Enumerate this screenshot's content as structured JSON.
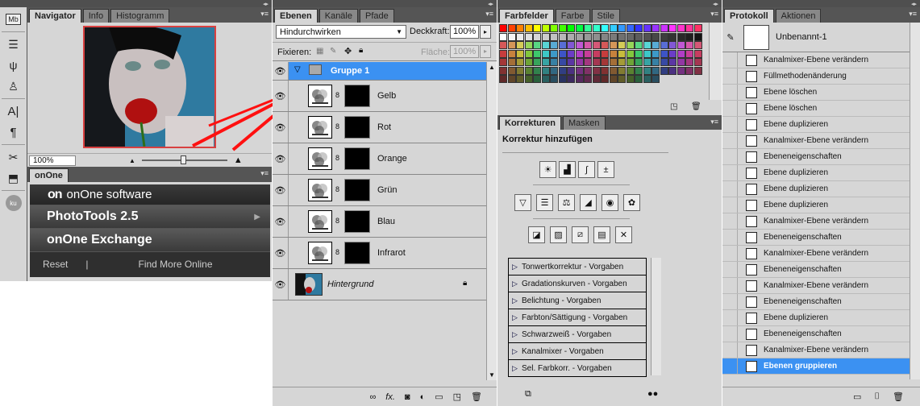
{
  "navigator_panel": {
    "tabs": [
      "Navigator",
      "Info",
      "Histogramm"
    ],
    "zoom": "100%"
  },
  "onone_panel": {
    "tab": "onOne",
    "logo_mark": "on",
    "brand": "onOne software",
    "item1": "PhotoTools 2.5",
    "item2": "onOne Exchange",
    "reset": "Reset",
    "sep": "|",
    "find_more": "Find More Online"
  },
  "layers_panel": {
    "tabs": [
      "Ebenen",
      "Kanäle",
      "Pfade"
    ],
    "blend_mode": "Hindurchwirken",
    "opacity_label": "Deckkraft:",
    "opacity": "100%",
    "fix_label": "Fixieren:",
    "fill_label": "Fläche:",
    "fill": "100%",
    "group": "Gruppe 1",
    "layers": [
      "Gelb",
      "Rot",
      "Orange",
      "Grün",
      "Blau",
      "Infrarot"
    ],
    "background": "Hintergrund",
    "bottom_icons": [
      "link-icon",
      "fx-icon",
      "mask-icon",
      "adjustment-icon",
      "folder-icon",
      "new-layer-icon",
      "trash-icon"
    ]
  },
  "swatches_panel": {
    "tabs": [
      "Farbfelder",
      "Farbe",
      "Stile"
    ]
  },
  "corrections_panel": {
    "tabs": [
      "Korrekturen",
      "Masken"
    ],
    "title": "Korrektur hinzufügen",
    "presets": [
      "Tonwertkorrektur - Vorgaben",
      "Gradationskurven - Vorgaben",
      "Belichtung - Vorgaben",
      "Farbton/Sättigung - Vorgaben",
      "Schwarzweiß - Vorgaben",
      "Kanalmixer - Vorgaben",
      "Sel. Farbkorr. - Vorgaben"
    ]
  },
  "history_panel": {
    "tabs": [
      "Protokoll",
      "Aktionen"
    ],
    "snapshot": "Unbenannt-1",
    "items": [
      "Kanalmixer-Ebene verändern",
      "Füllmethodenänderung",
      "Ebene löschen",
      "Ebene löschen",
      "Ebene duplizieren",
      "Kanalmixer-Ebene verändern",
      "Ebeneneigenschaften",
      "Ebene duplizieren",
      "Ebene duplizieren",
      "Ebene duplizieren",
      "Kanalmixer-Ebene verändern",
      "Ebeneneigenschaften",
      "Kanalmixer-Ebene verändern",
      "Ebeneneigenschaften",
      "Kanalmixer-Ebene verändern",
      "Ebeneneigenschaften",
      "Ebene duplizieren",
      "Ebeneneigenschaften",
      "Kanalmixer-Ebene verändern",
      "Ebenen gruppieren"
    ],
    "selected_index": 19
  }
}
